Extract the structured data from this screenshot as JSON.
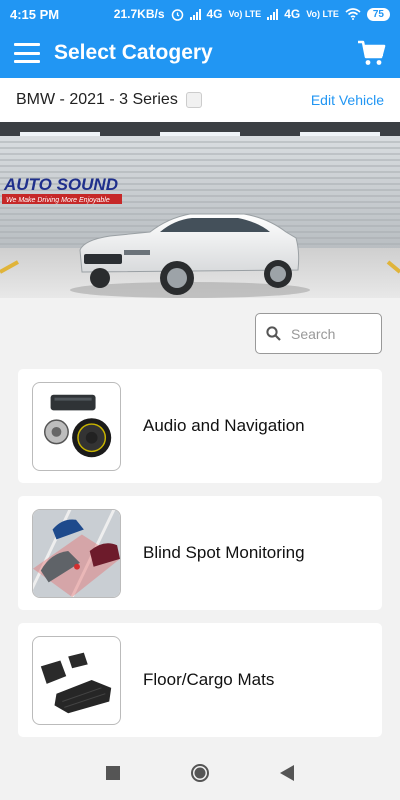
{
  "status_bar": {
    "time": "4:15 PM",
    "speed": "21.7KB/s",
    "net1": "4G",
    "net2": "4G",
    "volte": "Vo) LTE",
    "battery": "75"
  },
  "app_bar": {
    "title": "Select Catogery"
  },
  "vehicle": {
    "name": "BMW - 2021 - 3 Series",
    "edit_label": "Edit Vehicle"
  },
  "banner": {
    "brand_line1": "AUTO SOUND",
    "brand_tagline": "We Make Driving More Enjoyable"
  },
  "search": {
    "placeholder": "Search",
    "value": ""
  },
  "categories": [
    {
      "label": "Audio and Navigation",
      "icon": "speaker-amplifier-thumb"
    },
    {
      "label": "Blind Spot Monitoring",
      "icon": "blind-spot-cars-thumb"
    },
    {
      "label": "Floor/Cargo Mats",
      "icon": "floor-mats-thumb"
    }
  ],
  "colors": {
    "primary": "#2196f3",
    "background": "#f2f2f2",
    "card": "#ffffff"
  }
}
